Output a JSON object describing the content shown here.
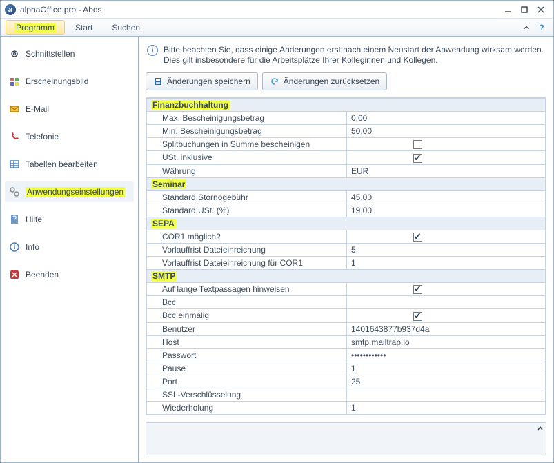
{
  "window": {
    "title": "alphaOffice pro - Abos"
  },
  "menu": {
    "programm": "Programm",
    "start": "Start",
    "suchen": "Suchen"
  },
  "sidebar": {
    "items": [
      {
        "label": "Schnittstellen"
      },
      {
        "label": "Erscheinungsbild"
      },
      {
        "label": "E-Mail"
      },
      {
        "label": "Telefonie"
      },
      {
        "label": "Tabellen bearbeiten"
      },
      {
        "label": "Anwendungseinstellungen"
      },
      {
        "label": "Hilfe"
      },
      {
        "label": "Info"
      },
      {
        "label": "Beenden"
      }
    ]
  },
  "info": {
    "line1": "Bitte beachten Sie, dass einige Änderungen erst nach einem Neustart der Anwendung wirksam werden.",
    "line2": "Dies gilt insbesondere für die Arbeitsplätze Ihrer Kolleginnen und Kollegen."
  },
  "toolbar": {
    "save": "Änderungen speichern",
    "reset": "Änderungen zurücksetzen"
  },
  "cats": {
    "fin": "Finanzbuchhaltung",
    "sem": "Seminar",
    "sepa": "SEPA",
    "smtp": "SMTP"
  },
  "rows": {
    "fin_max_k": "Max. Bescheinigungsbetrag",
    "fin_max_v": "0,00",
    "fin_min_k": "Min. Bescheinigungsbetrag",
    "fin_min_v": "50,00",
    "fin_split_k": "Splitbuchungen in Summe bescheinigen",
    "fin_ust_k": "USt. inklusive",
    "fin_cur_k": "Währung",
    "fin_cur_v": "EUR",
    "sem_storno_k": "Standard Stornogebühr",
    "sem_storno_v": "45,00",
    "sem_ust_k": "Standard USt. (%)",
    "sem_ust_v": "19,00",
    "sepa_cor1_k": "COR1 möglich?",
    "sepa_vor_k": "Vorlauffrist Dateieinreichung",
    "sepa_vor_v": "5",
    "sepa_vorcor_k": "Vorlauffrist Dateieinreichung für COR1",
    "sepa_vorcor_v": "1",
    "smtp_long_k": "Auf lange Textpassagen hinweisen",
    "smtp_bcc_k": "Bcc",
    "smtp_bcc_v": "",
    "smtp_bcconce_k": "Bcc einmalig",
    "smtp_user_k": "Benutzer",
    "smtp_user_v": "1401643877b937d4a",
    "smtp_host_k": "Host",
    "smtp_host_v": "smtp.mailtrap.io",
    "smtp_pw_k": "Passwort",
    "smtp_pw_v": "••••••••••••",
    "smtp_pause_k": "Pause",
    "smtp_pause_v": "1",
    "smtp_port_k": "Port",
    "smtp_port_v": "25",
    "smtp_ssl_k": "SSL-Verschlüsselung",
    "smtp_ssl_v": "",
    "smtp_retry_k": "Wiederholung",
    "smtp_retry_v": "1"
  }
}
